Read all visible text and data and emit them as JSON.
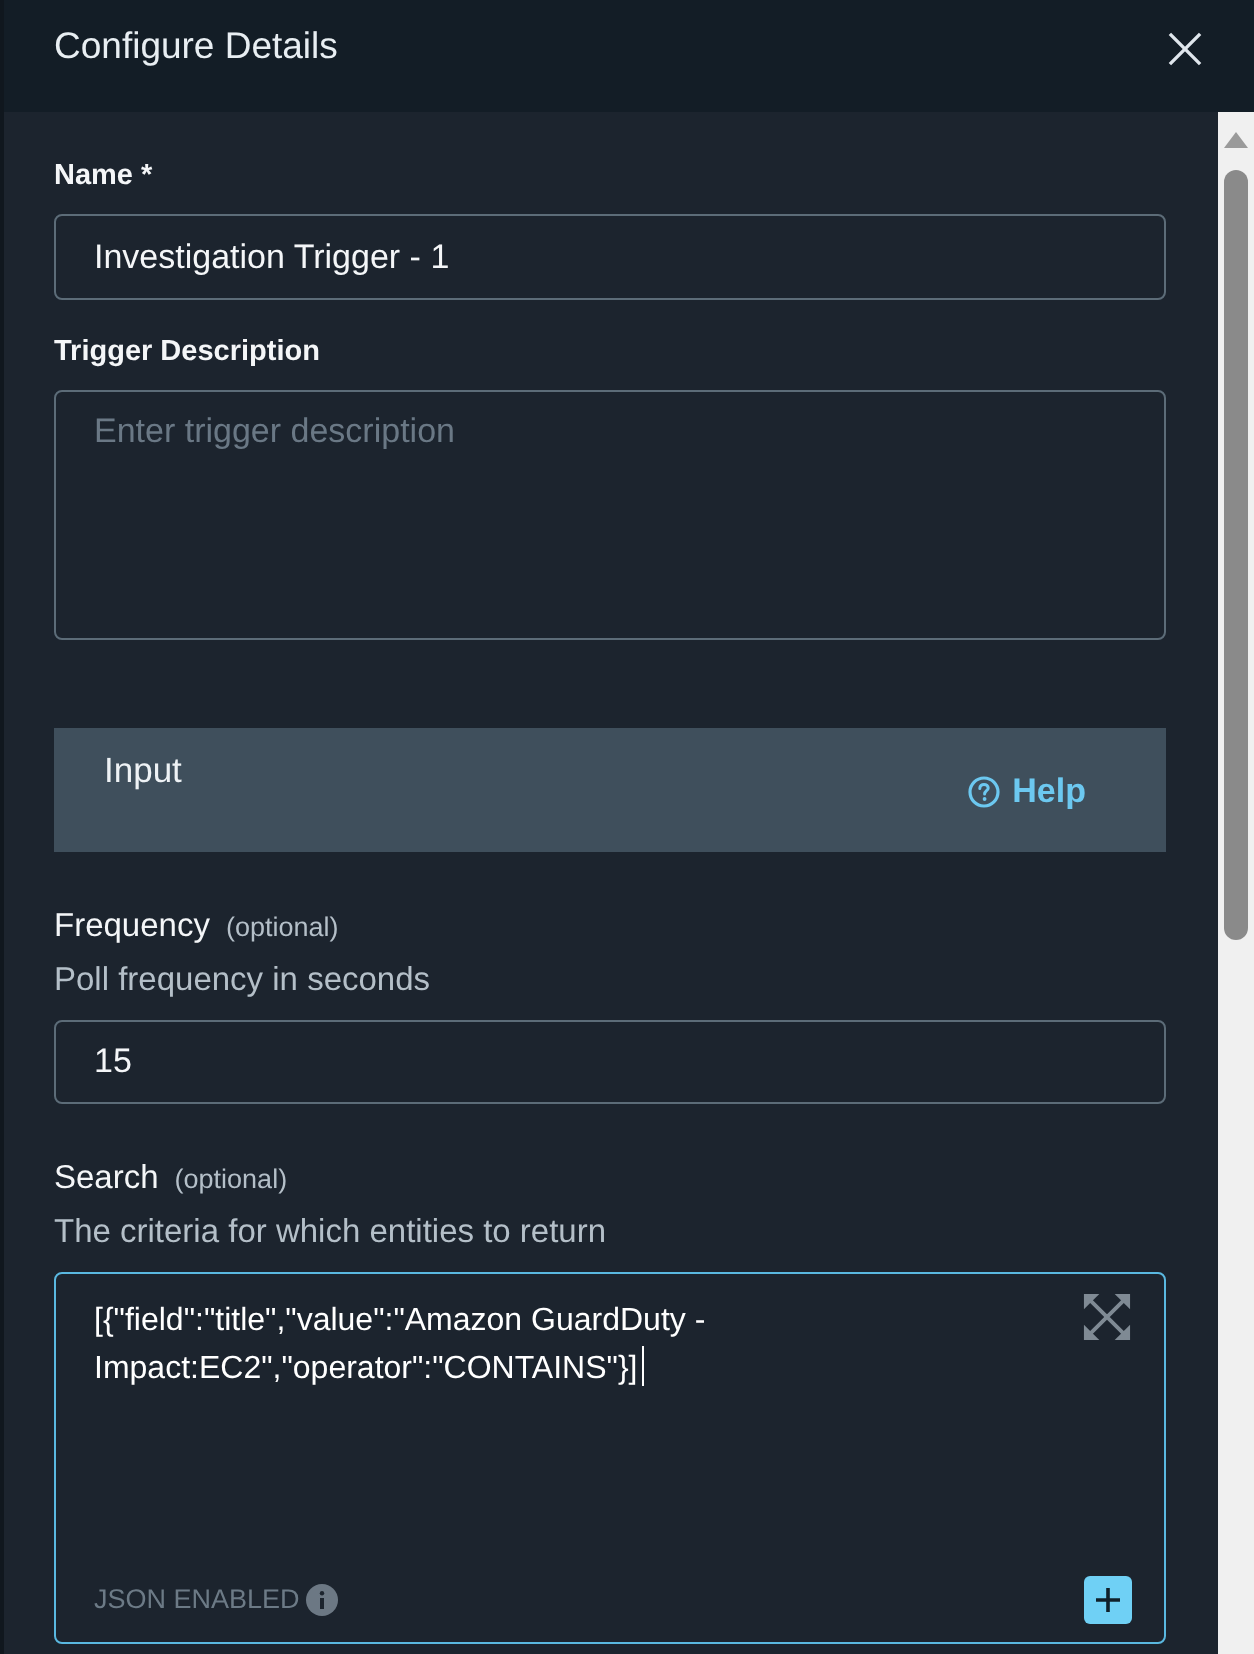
{
  "header": {
    "title": "Configure Details"
  },
  "fields": [
    {
      "kind": "input",
      "label": "Name *",
      "value": "Investigation Trigger - 1"
    },
    {
      "kind": "textarea",
      "label": "Trigger Description",
      "placeholder": "Enter trigger description"
    }
  ],
  "section": {
    "title": "Input",
    "help": "Help",
    "fields": [
      {
        "kind": "input",
        "label": "Frequency",
        "optional": "(optional)",
        "hint": "Poll frequency in seconds",
        "value": "15"
      },
      {
        "kind": "code",
        "label": "Search",
        "optional": "(optional)",
        "hint": "The criteria for which entities to return",
        "value": "[{\"field\":\"title\",\"value\":\"Amazon GuardDuty - Impact:EC2\",\"operator\":\"CONTAINS\"}]",
        "focused": true,
        "footer": "JSON ENABLED"
      }
    ]
  }
}
